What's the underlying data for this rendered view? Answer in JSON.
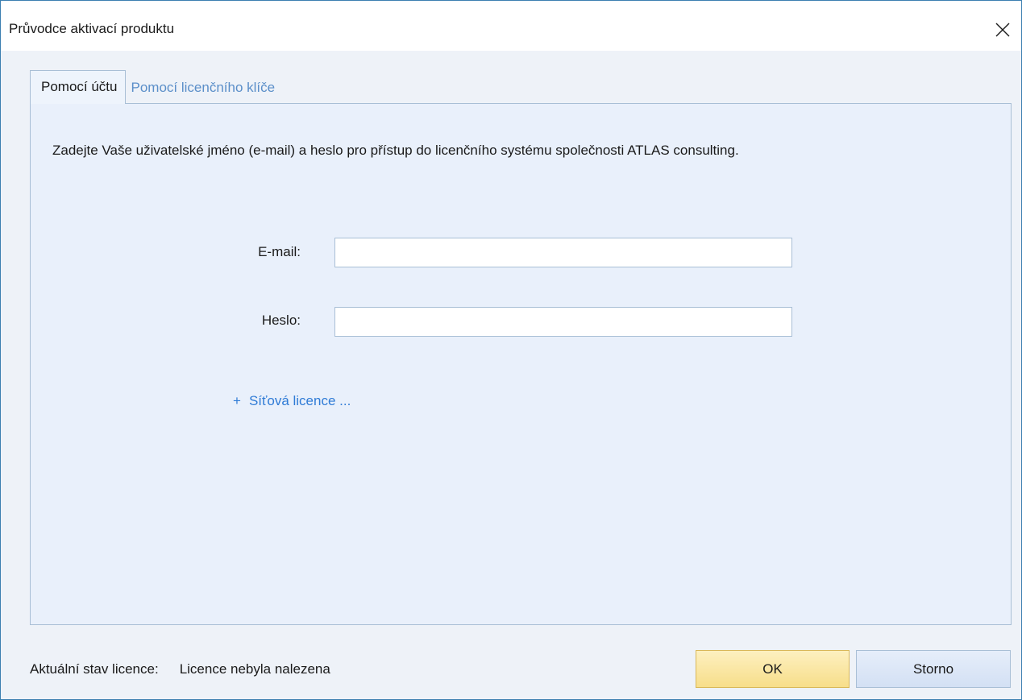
{
  "window": {
    "title": "Průvodce aktivací produktu"
  },
  "tabs": [
    {
      "label": "Pomocí účtu",
      "active": true
    },
    {
      "label": "Pomocí licenčního klíče",
      "active": false
    }
  ],
  "panel": {
    "instructions": "Zadejte Vaše uživatelské jméno (e-mail) a heslo pro přístup do licenčního systému společnosti ATLAS consulting.",
    "email_label": "E-mail:",
    "email_value": "",
    "password_label": "Heslo:",
    "password_value": "",
    "network_link_plus": "+",
    "network_link_label": "Síťová licence ..."
  },
  "status": {
    "label": "Aktuální stav licence:",
    "value": "Licence nebyla nalezena"
  },
  "buttons": {
    "ok_label": "OK",
    "cancel_label": "Storno"
  },
  "icons": {
    "close": "close-icon"
  },
  "colors": {
    "window_border": "#3c7fb1",
    "panel_background": "#e9f0fb",
    "link": "#2f7bd6",
    "ok_button": "#f7de8a",
    "cancel_button": "#d3e0f4"
  }
}
